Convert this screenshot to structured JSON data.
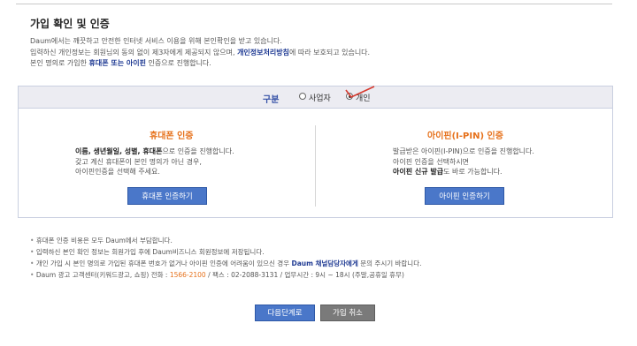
{
  "page": {
    "title": "가입 확인 및 인증",
    "intro_line1": "Daum에서는 깨끗하고 안전한 인터넷 서비스 이용을 위해 본인확인을 받고 있습니다.",
    "intro_line2_a": "입력하신 개인정보는 회원님의 동의 없이 제3자에게 제공되지 않으며, ",
    "intro_line2_link": "개인정보처리방침",
    "intro_line2_b": "에 따라 보호되고 있습니다.",
    "intro_line3_a": "본인 명의로 가입한 ",
    "intro_line3_link": "휴대폰 또는 아이핀",
    "intro_line3_b": " 인증으로 진행합니다."
  },
  "verify": {
    "gubun_label": "구분",
    "options": [
      {
        "label": "사업자",
        "checked": false
      },
      {
        "label": "개인",
        "checked": true
      }
    ],
    "phone": {
      "title": "휴대폰 인증",
      "line1_bold": "이름, 생년월일, 성별, 휴대폰",
      "line1_rest": "으로 인증을 진행합니다.",
      "line2": "갖고 계신 휴대폰이 본인 명의가 아닌 경우,",
      "line3": "아이핀인증을 선택해 주세요.",
      "button": "휴대폰 인증하기"
    },
    "ipin": {
      "title": "아이핀(I-PIN) 인증",
      "line1": "발급받은 아이핀(I-PIN)으로 인증을 진행합니다.",
      "line2": "아이핀 인증을 선택하시면",
      "line3_bold": "아이핀 신규 발급",
      "line3_rest": "도 바로 가능합니다.",
      "button": "아이핀 인증하기"
    }
  },
  "notes": {
    "n1": "휴대폰 인증 비용은 모두 Daum에서 부담합니다.",
    "n2": "입력하신 본인 확인 정보는 회원가입 후에 Daum비즈니스 회원정보에 저장됩니다.",
    "n3_a": "개인 가입 시 본인 명의로 가입된 휴대폰 번호가 없거나 아이핀 인증에 어려움이 있으신 경우 ",
    "n3_hl": "Daum 채널담당자에게",
    "n3_b": " 문의 주시기 바랍니다.",
    "n4_a": "Daum 광고 고객센터(키워드광고, 쇼핑) 전화 : ",
    "n4_tel": "1566-2100",
    "n4_b": " / 팩스 : 02-2088-3131 / 업무시간 : 9시 ~ 18시 (주말,공휴일 휴무)"
  },
  "actions": {
    "next": "다음단계로",
    "cancel": "가입 취소"
  },
  "colors": {
    "accent_blue": "#4a77c9",
    "title_orange": "#e6711b",
    "cancel_gray": "#7a7a7a"
  }
}
